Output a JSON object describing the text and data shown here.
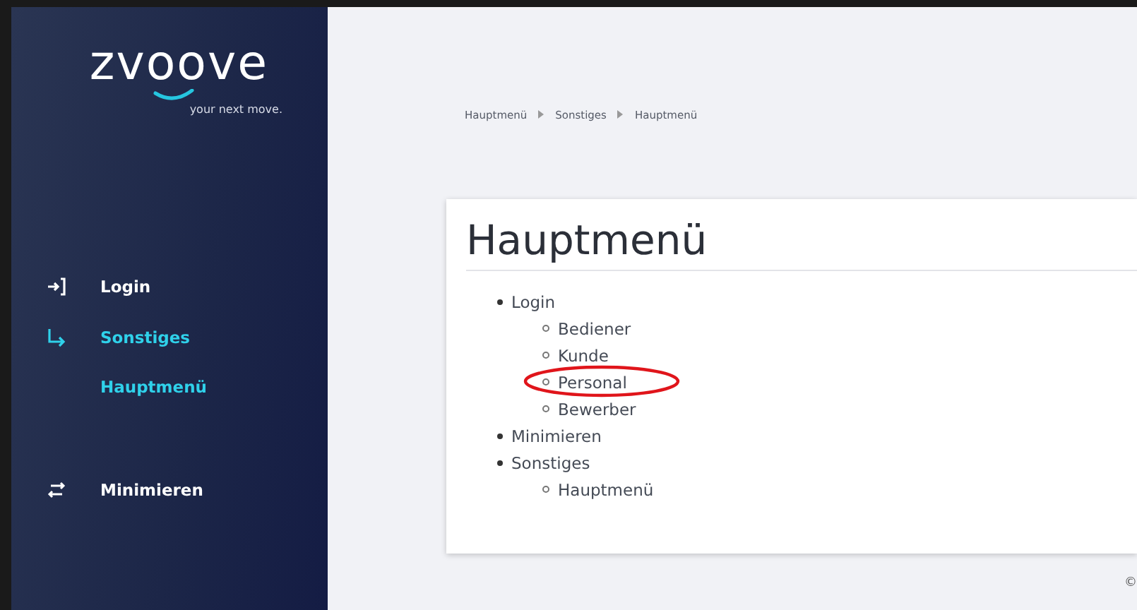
{
  "sidebar": {
    "logo": "zvoove",
    "tagline": "your next move.",
    "items": [
      {
        "label": "Login",
        "selected": false
      },
      {
        "label": "Sonstiges",
        "selected": true,
        "children": [
          {
            "label": "Hauptmenü",
            "selected": true
          }
        ]
      }
    ],
    "minimize": {
      "label": "Minimieren"
    }
  },
  "breadcrumb": [
    "Hauptmenü",
    "Sonstiges",
    "Hauptmenü"
  ],
  "page": {
    "title": "Hauptmenü",
    "tree": [
      {
        "label": "Login",
        "children": [
          {
            "label": "Bediener",
            "circled": false
          },
          {
            "label": "Kunde",
            "circled": false
          },
          {
            "label": "Personal",
            "circled": true
          },
          {
            "label": "Bewerber",
            "circled": false
          }
        ]
      },
      {
        "label": "Minimieren"
      },
      {
        "label": "Sonstiges",
        "children": [
          {
            "label": "Hauptmenü",
            "circled": false
          }
        ]
      }
    ]
  },
  "footer": "©"
}
